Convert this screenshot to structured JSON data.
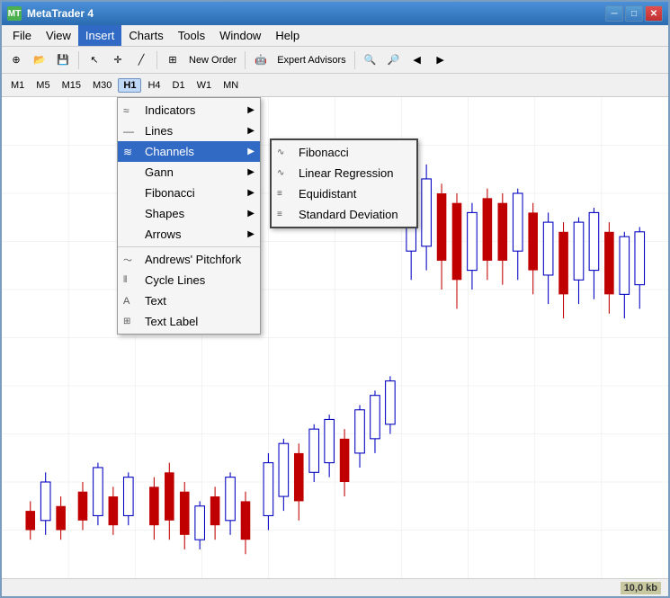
{
  "window": {
    "title": "MetaTrader 4",
    "icon": "MT"
  },
  "titleControls": {
    "minimize": "─",
    "maximize": "□",
    "close": "✕"
  },
  "menuBar": {
    "items": [
      {
        "id": "file",
        "label": "File"
      },
      {
        "id": "view",
        "label": "View"
      },
      {
        "id": "insert",
        "label": "Insert",
        "active": true
      },
      {
        "id": "charts",
        "label": "Charts"
      },
      {
        "id": "tools",
        "label": "Tools"
      },
      {
        "id": "window",
        "label": "Window"
      },
      {
        "id": "help",
        "label": "Help"
      }
    ]
  },
  "toolbar2": {
    "timeframes": [
      {
        "id": "m1",
        "label": "M1"
      },
      {
        "id": "m5",
        "label": "M5"
      },
      {
        "id": "m15",
        "label": "M15"
      },
      {
        "id": "m30",
        "label": "M30"
      },
      {
        "id": "h1",
        "label": "H1",
        "active": true
      },
      {
        "id": "h4",
        "label": "H4"
      },
      {
        "id": "d1",
        "label": "D1"
      },
      {
        "id": "w1",
        "label": "W1"
      },
      {
        "id": "mn",
        "label": "MN"
      }
    ]
  },
  "insertMenu": {
    "items": [
      {
        "id": "indicators",
        "label": "Indicators",
        "hasSubmenu": true,
        "icon": ""
      },
      {
        "id": "lines",
        "label": "Lines",
        "hasSubmenu": true,
        "icon": ""
      },
      {
        "id": "channels",
        "label": "Channels",
        "hasSubmenu": true,
        "icon": "",
        "highlighted": true
      },
      {
        "id": "gann",
        "label": "Gann",
        "hasSubmenu": true,
        "icon": ""
      },
      {
        "id": "fibonacci",
        "label": "Fibonacci",
        "hasSubmenu": true,
        "icon": ""
      },
      {
        "id": "shapes",
        "label": "Shapes",
        "hasSubmenu": true,
        "icon": ""
      },
      {
        "id": "arrows",
        "label": "Arrows",
        "hasSubmenu": true,
        "icon": ""
      },
      {
        "separator": true
      },
      {
        "id": "andrews-pitchfork",
        "label": "Andrews' Pitchfork",
        "icon": "~"
      },
      {
        "id": "cycle-lines",
        "label": "Cycle Lines",
        "icon": "|||"
      },
      {
        "id": "text",
        "label": "Text",
        "icon": "A"
      },
      {
        "id": "text-label",
        "label": "Text Label",
        "icon": "T"
      }
    ]
  },
  "channelsSubmenu": {
    "items": [
      {
        "id": "fibonacci-channel",
        "label": "Fibonacci",
        "icon": "~"
      },
      {
        "id": "linear-regression",
        "label": "Linear Regression",
        "icon": "~"
      },
      {
        "id": "equidistant",
        "label": "Equidistant",
        "icon": "~"
      },
      {
        "id": "standard-deviation",
        "label": "Standard Deviation",
        "icon": "~"
      }
    ]
  },
  "statusBar": {
    "info": "10,0 kb"
  },
  "expertAdvisors": {
    "label": "Expert Advisors"
  }
}
